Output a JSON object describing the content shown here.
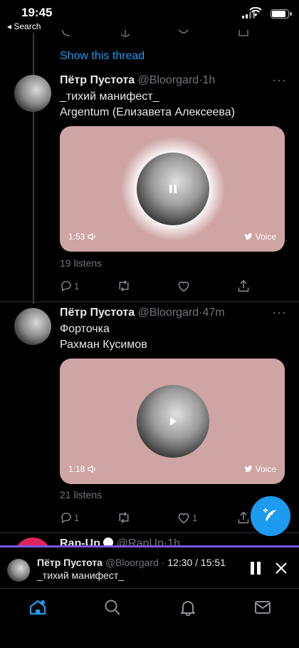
{
  "status_bar": {
    "time": "19:45",
    "back_label": "◂ Search"
  },
  "thread": {
    "show_thread": "Show this thread"
  },
  "tweets": [
    {
      "author": "Пётр Пустота",
      "handle": "@Bloorgard",
      "time": "1h",
      "lines": [
        "_тихий манифест_",
        "Argentum (Елизавета Алексеева)"
      ],
      "voice": {
        "duration": "1:53",
        "label": "Voice",
        "state": "playing"
      },
      "listens": "19 listens",
      "reply_count": "1",
      "like_count": ""
    },
    {
      "author": "Пётр Пустота",
      "handle": "@Bloorgard",
      "time": "47m",
      "lines": [
        "Форточка",
        "Рахман Кусимов"
      ],
      "voice": {
        "duration": "1:18",
        "label": "Voice",
        "state": "paused"
      },
      "listens": "21 listens",
      "reply_count": "1",
      "like_count": "1"
    }
  ],
  "next_tweet": {
    "author": "Rap-Up",
    "handle": "@RapUp",
    "time": "1h"
  },
  "player": {
    "author": "Пётр Пустота",
    "handle": "@Bloorgard",
    "progress_text": "12:30 / 15:51",
    "progress": 0.79,
    "title": "_тихий манифест_"
  },
  "colors": {
    "accent": "#1d9bf0",
    "card": "#cfa4a4",
    "progress": "#7a55e0"
  },
  "tabs": [
    "home-icon",
    "search-icon",
    "notifications-icon",
    "messages-icon"
  ]
}
